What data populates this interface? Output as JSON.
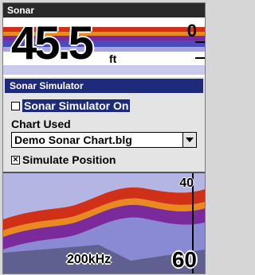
{
  "window": {
    "title": "Sonar"
  },
  "display": {
    "depth_value": "45.5",
    "depth_unit": "ft",
    "scale_top": "0",
    "scale_mid": "40",
    "scale_bottom": "60",
    "frequency": "200kHz"
  },
  "dialog": {
    "title": "Sonar Simulator",
    "simulator_on_label": "Sonar Simulator On",
    "simulator_on_checked": false,
    "chart_used_label": "Chart Used",
    "chart_selected": "Demo Sonar Chart.blg",
    "simulate_position_label": "Simulate Position",
    "simulate_position_checked": true
  },
  "colors": {
    "title_bg": "#2a2a2a",
    "dialog_title_bg": "#1e2a7a",
    "sonar_red": "#d03018",
    "sonar_orange": "#e88a20",
    "sonar_blue": "#2a2ab0",
    "sonar_purple": "#7a2a9a"
  }
}
